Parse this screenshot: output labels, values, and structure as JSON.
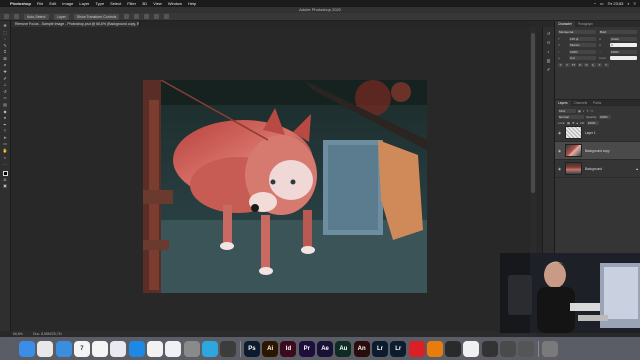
{
  "menubar": {
    "app_name": "Photoshop",
    "items": [
      "File",
      "Edit",
      "Image",
      "Layer",
      "Type",
      "Select",
      "Filter",
      "3D",
      "View",
      "Window",
      "Help"
    ],
    "clock": "Пт 23:53"
  },
  "window": {
    "title": "Adobe Photoshop 2020"
  },
  "options": {
    "auto_select": "Auto-Select:",
    "layer_select": "Layer",
    "show_transform": "Show Transform Controls"
  },
  "document": {
    "tab_title": "Remove Focus - Sample Image - Photoshop.psd @ 66,6% (Background copy, RGB/8#) *"
  },
  "status": {
    "zoom": "66,6%",
    "doc_size": "Doc: 8,58M/25,7M"
  },
  "panels": {
    "tabs": [
      "Character",
      "Paragraph"
    ],
    "character": {
      "font_family": "Montserrat",
      "font_style": "Bold",
      "size": "125 pt",
      "leading": "(Auto)",
      "tracking": "0",
      "kerning": "Metrics",
      "scale_v": "100%",
      "scale_h": "100%",
      "baseline": "0 pt",
      "color_label": "Color:"
    },
    "layers_tabs": [
      "Layers",
      "Channels",
      "Paths"
    ],
    "layers_filter": "Kind",
    "blend_mode": "Normal",
    "opacity_label": "Opacity:",
    "opacity": "100%",
    "lock_label": "Lock:",
    "fill_label": "Fill:",
    "fill": "100%",
    "layers": [
      {
        "name": "Layer 1",
        "thumb": "blank",
        "selected": false
      },
      {
        "name": "Background copy",
        "thumb": "photo",
        "selected": true
      },
      {
        "name": "Background",
        "thumb": "photo",
        "selected": false
      }
    ]
  },
  "dock": [
    {
      "name": "finder",
      "label": "",
      "color": "#3a8ee6"
    },
    {
      "name": "chrome",
      "label": "",
      "color": "#e8e8e8"
    },
    {
      "name": "safari",
      "label": "",
      "color": "#3b8de0"
    },
    {
      "name": "calendar",
      "label": "7",
      "color": "#f4f4f4"
    },
    {
      "name": "notes",
      "label": "",
      "color": "#f5f5f5"
    },
    {
      "name": "preview",
      "label": "",
      "color": "#e9e9ef"
    },
    {
      "name": "app-store",
      "label": "",
      "color": "#1e88e5"
    },
    {
      "name": "photos",
      "label": "",
      "color": "#f2f2f2"
    },
    {
      "name": "itunes",
      "label": "",
      "color": "#f0f0f5"
    },
    {
      "name": "system-preferences",
      "label": "",
      "color": "#8a8a8a"
    },
    {
      "name": "telegram",
      "label": "",
      "color": "#2ea6df"
    },
    {
      "name": "scripts",
      "label": "",
      "color": "#3c3c3c"
    },
    {
      "name": "photoshop",
      "label": "Ps",
      "color": "#0c1b2e"
    },
    {
      "name": "illustrator",
      "label": "Ai",
      "color": "#2c1600"
    },
    {
      "name": "indesign",
      "label": "Id",
      "color": "#3b0a1e"
    },
    {
      "name": "premiere",
      "label": "Pr",
      "color": "#1e0f3a"
    },
    {
      "name": "after-effects",
      "label": "Ae",
      "color": "#1a1236"
    },
    {
      "name": "audition",
      "label": "Au",
      "color": "#0f2c22"
    },
    {
      "name": "animate",
      "label": "An",
      "color": "#2a0d0a"
    },
    {
      "name": "lightroom-classic",
      "label": "Lr",
      "color": "#0c1b2e"
    },
    {
      "name": "lightroom",
      "label": "Lr",
      "color": "#0c1b2e"
    },
    {
      "name": "creative-cloud",
      "label": "",
      "color": "#da1f26"
    },
    {
      "name": "blender",
      "label": "",
      "color": "#e87d0d"
    },
    {
      "name": "final-cut",
      "label": "",
      "color": "#2a2a2a"
    },
    {
      "name": "motion",
      "label": "",
      "color": "#f0f0f0"
    },
    {
      "name": "camera",
      "label": "",
      "color": "#333333"
    },
    {
      "name": "game",
      "label": "",
      "color": "#4a4a4a"
    },
    {
      "name": "calculator",
      "label": "",
      "color": "#555555"
    },
    {
      "name": "trash",
      "label": "",
      "color": "#7a7a7a"
    }
  ],
  "colors": {
    "accent": "#2d8ceb",
    "panel": "#353535",
    "canvas_bg": "#282828"
  }
}
